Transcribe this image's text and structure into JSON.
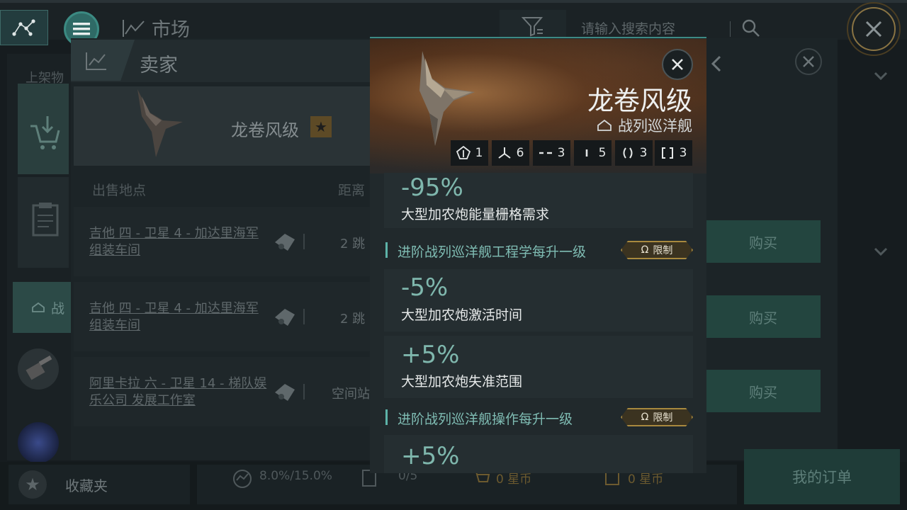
{
  "topbar": {
    "market_title": "市场",
    "search_placeholder": "请输入搜索内容"
  },
  "seller_panel": {
    "title": "卖家",
    "shelf_tab": "上架物",
    "ship_name": "龙卷风级",
    "columns": {
      "location": "出售地点",
      "distance": "距离"
    },
    "rows": [
      {
        "location": "吉他 四 - 卫星 4 - 加达里海军 组装车间",
        "distance": "2 跳",
        "buy": "购买"
      },
      {
        "location": "吉他 四 - 卫星 4 - 加达里海军 组装车间",
        "distance": "2 跳",
        "buy": "购买"
      },
      {
        "location": "阿里卡拉 六 - 卫星 14 - 梯队娱乐公司 发展工作室",
        "distance": "空间站",
        "buy": "购买"
      }
    ]
  },
  "left_rail": {
    "tag_label": "战"
  },
  "bottombar": {
    "favorites": "收藏夹",
    "tax": "8.0%/15.0%",
    "orders": "0/5",
    "isk_a": "0 星币",
    "isk_b": "0 星币",
    "my_orders": "我的订单"
  },
  "modal": {
    "ship_name": "龙卷风级",
    "ship_class": "战列巡洋舰",
    "slots": [
      {
        "icon": "high-slot-icon",
        "count": "1"
      },
      {
        "icon": "turret-icon",
        "count": "6"
      },
      {
        "icon": "medium-slot-icon",
        "count": "3"
      },
      {
        "icon": "low-slot-icon",
        "count": "5"
      },
      {
        "icon": "rig-icon",
        "count": "3"
      },
      {
        "icon": "cargo-icon",
        "count": "3"
      }
    ],
    "bonuses": [
      {
        "value": "-95%",
        "desc": "大型加农炮能量栅格需求"
      },
      {
        "value": "-5%",
        "desc": "大型加农炮激活时间"
      },
      {
        "value": "+5%",
        "desc": "大型加农炮失准范围"
      },
      {
        "value": "+5%",
        "desc": ""
      }
    ],
    "skills": [
      {
        "name": "进阶战列巡洋舰工程学每升一级",
        "badge": "限制"
      },
      {
        "name": "进阶战列巡洋舰操作每升一级",
        "badge": "限制"
      }
    ]
  },
  "colors": {
    "accent_teal": "#5db3a9",
    "bonus_value": "#7fb7ad",
    "limit_gold": "#a8893e"
  }
}
